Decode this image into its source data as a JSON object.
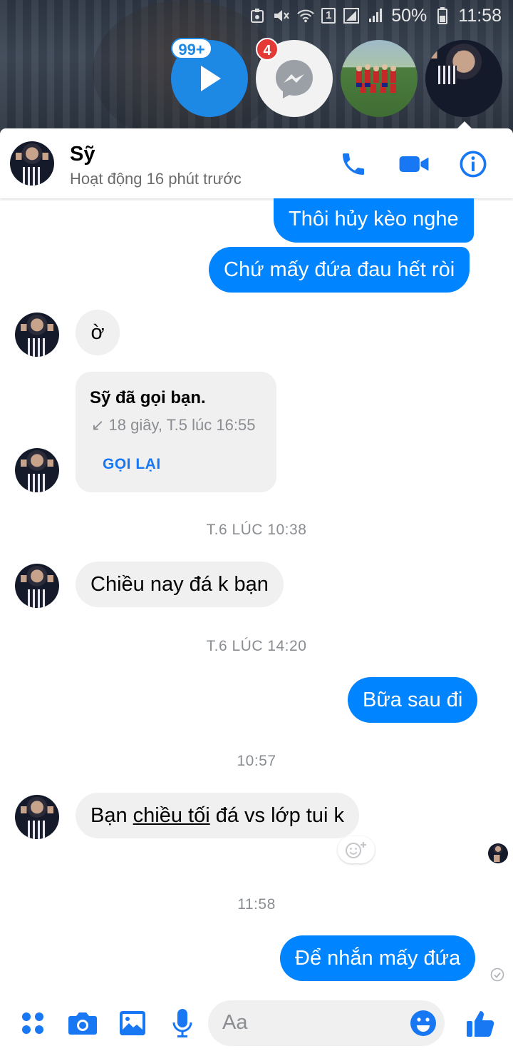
{
  "status_bar": {
    "battery": "50%",
    "time": "11:58",
    "sim_indicator": "1"
  },
  "chat_heads": {
    "play_badge": "99+",
    "messenger_badge": "4"
  },
  "header": {
    "name": "Sỹ",
    "status": "Hoạt động 16 phút trước"
  },
  "messages": {
    "m1": "Thôi hủy kèo nghe",
    "m2": "Chứ mấy đứa đau hết ròi",
    "m3": "ờ",
    "call_title": "Sỹ đã gọi bạn.",
    "call_sub": "↙ 18 giây, T.5 lúc 16:55",
    "call_again": "GỌI LẠI",
    "ts1": "T.6 LÚC 10:38",
    "m4": "Chiều nay đá k bạn",
    "ts2": "T.6 LÚC 14:20",
    "m5": "Bữa sau đi",
    "ts3": "10:57",
    "m6_pre": "Bạn ",
    "m6_link": "chiều tối",
    "m6_post": " đá vs lớp tui k",
    "ts4": "11:58",
    "m7": "Để nhắn mấy đứa"
  },
  "composer": {
    "placeholder": "Aa"
  },
  "colors": {
    "accent": "#0084ff",
    "incoming_bubble": "#f1f0f0",
    "icon_blue": "#1877f2"
  }
}
